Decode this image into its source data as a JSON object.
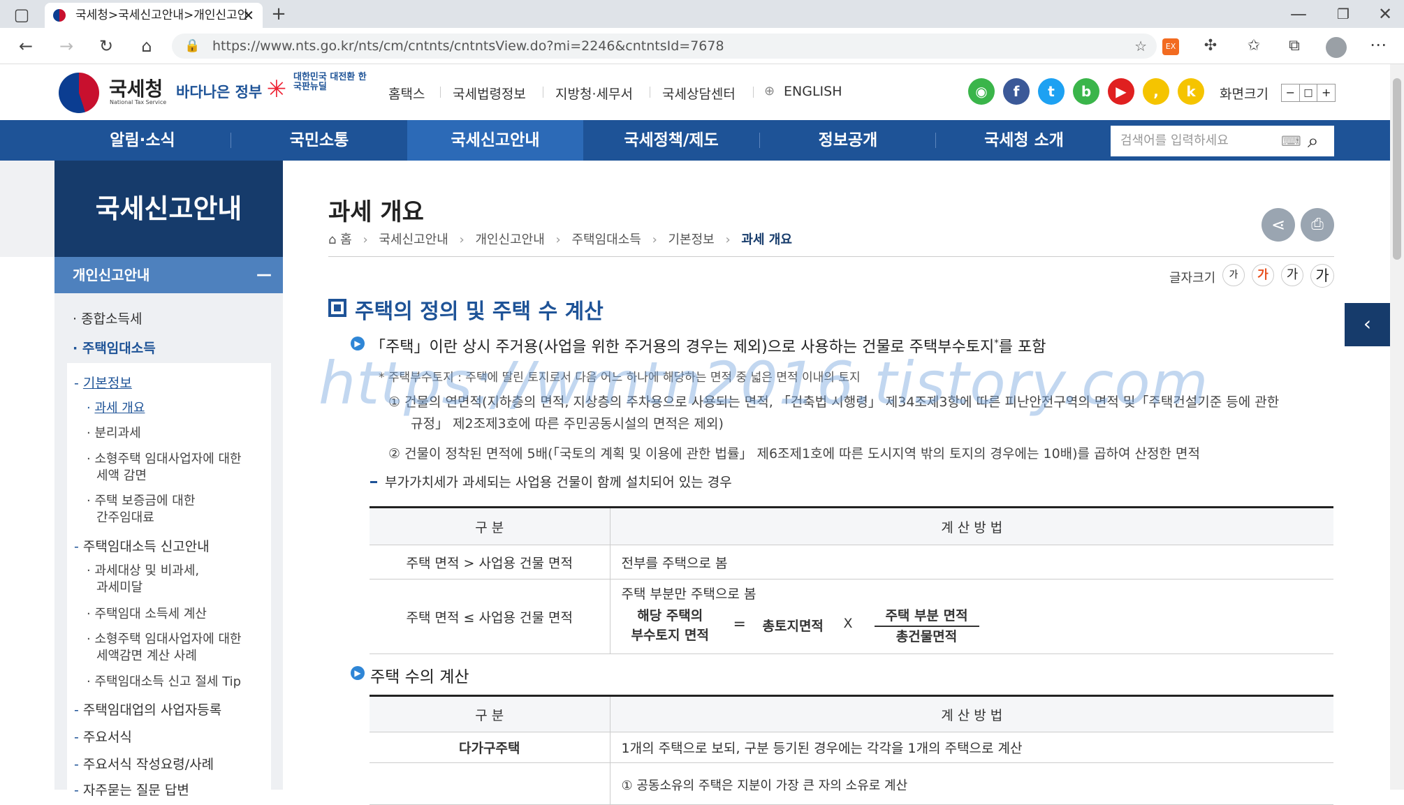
{
  "browser": {
    "tab_title": "국세청>국세신고안내>개인신고안",
    "url": "https://www.nts.go.kr/nts/cm/cntnts/cntntsView.do?mi=2246&cntntsId=7678"
  },
  "header": {
    "logo_text": "국세청",
    "logo_sub": "National Tax Service",
    "gov_logo": "바다나은 정부",
    "newdeal_logo": "대한민국 대전환 한국판뉴딜",
    "top_links": [
      "홈택스",
      "국세법령정보",
      "지방청·세무서",
      "국세상담센터"
    ],
    "english": "ENGLISH",
    "screen_size_label": "화면크기",
    "zoom_buttons": [
      "−",
      "□",
      "+"
    ]
  },
  "gnb": {
    "items": [
      "알림·소식",
      "국민소통",
      "국세신고안내",
      "국세정책/제도",
      "정보공개",
      "국세청 소개"
    ],
    "search_placeholder": "검색어를 입력하세요"
  },
  "lnb": {
    "title": "국세신고안내",
    "section": "개인신고안내",
    "items": [
      {
        "label": "종합소득세"
      },
      {
        "label": "주택임대소득"
      },
      {
        "label": "기본정보"
      },
      {
        "label": "과세 개요"
      },
      {
        "label": "분리과세"
      },
      {
        "label": "소형주택 임대사업자에 대한 세액 감면",
        "line1": "소형주택 임대사업자에 대한",
        "line2": "세액 감면"
      },
      {
        "label": "주택 보증금에 대한 간주임대료",
        "line1": "주택 보증금에 대한",
        "line2": "간주임대료"
      },
      {
        "label": "주택임대소득 신고안내"
      },
      {
        "label": "과세대상 및 비과세, 과세미달",
        "line1": "과세대상 및 비과세,",
        "line2": "과세미달"
      },
      {
        "label": "주택임대 소득세 계산"
      },
      {
        "label": "소형주택 임대사업자에 대한 세액감면 계산 사례",
        "line1": "소형주택 임대사업자에 대한",
        "line2": "세액감면 계산 사례"
      },
      {
        "label": "주택임대소득 신고 절세 Tip"
      },
      {
        "label": "주택임대업의 사업자등록"
      },
      {
        "label": "주요서식"
      },
      {
        "label": "주요서식 작성요령/사례"
      },
      {
        "label": "자주묻는 질문 답변"
      }
    ]
  },
  "page": {
    "title": "과세 개요",
    "breadcrumb": [
      "홈",
      "국세신고안내",
      "개인신고안내",
      "주택임대소득",
      "기본정보",
      "과세 개요"
    ],
    "font_size_label": "글자크기",
    "font_buttons": [
      "가",
      "가",
      "가",
      "가"
    ],
    "section1_title": "주택의 정의 및 주택 수 계산",
    "bullet1": "「주택」이란 상시 주거용(사업을 위한 주거용의 경우는 제외)으로 사용하는 건물로 주택부수토지",
    "bullet1_sup": "*",
    "bullet1_tail": "를 포함",
    "note_head": "* 주택부수토지 : 주택에 딸린 토지로서 다음 어느 하나에 해당하는 면적 중 넓은 면적 이내의 토지",
    "note1_a": "① 건물의 연면적(지하층의 면적, 지상층의 주차용으로 사용되는 면적, 「건축법 시행령」 제34조제3항에 따른 피난안전구역의 면적 및「주택건설기준 등에 관한",
    "note1_b": "규정」 제2조제3호에 따른 주민공동시설의 면적은 제외)",
    "note2": "② 건물이 정착된 면적에 5배(「국토의 계획 및 이용에 관한 법률」 제6조제1호에 따른 도시지역 밖의 토지의 경우에는 10배)를 곱하여 산정한 면적",
    "dash1": "부가가치세가 과세되는 사업용 건물이 함께 설치되어 있는 경우",
    "table1": {
      "headers": [
        "구 분",
        "계 산 방 법"
      ],
      "row1": [
        "주택 면적 > 사업용 건물 면적",
        "전부를 주택으로 봄"
      ],
      "row2_left": "주택 면적 ≤ 사업용 건물 면적",
      "row2_right_head": "주택 부분만 주택으로 봄",
      "formula": {
        "lhs1": "해당 주택의",
        "lhs2": "부수토지 면적",
        "eq": "=",
        "mid": "총토지면적",
        "times": "X",
        "num": "주택 부분 면적",
        "den": "총건물면적"
      }
    },
    "section2_title": "주택 수의 계산",
    "table2": {
      "headers": [
        "구 분",
        "계 산 방 법"
      ],
      "row1": [
        "다가구주택",
        "1개의 주택으로 보되, 구분 등기된 경우에는 각각을 1개의 주택으로 계산"
      ],
      "row2_partial": "① 공동소유의 주택은 지분이 가장 큰 자의 소유로 계산"
    },
    "watermark": "https://wmtn2016.tistory.com"
  },
  "colors": {
    "gnb": "#1e5397",
    "lnb_title": "#163b6b",
    "lnb_section": "#4e81be",
    "accent": "#1e5397"
  }
}
